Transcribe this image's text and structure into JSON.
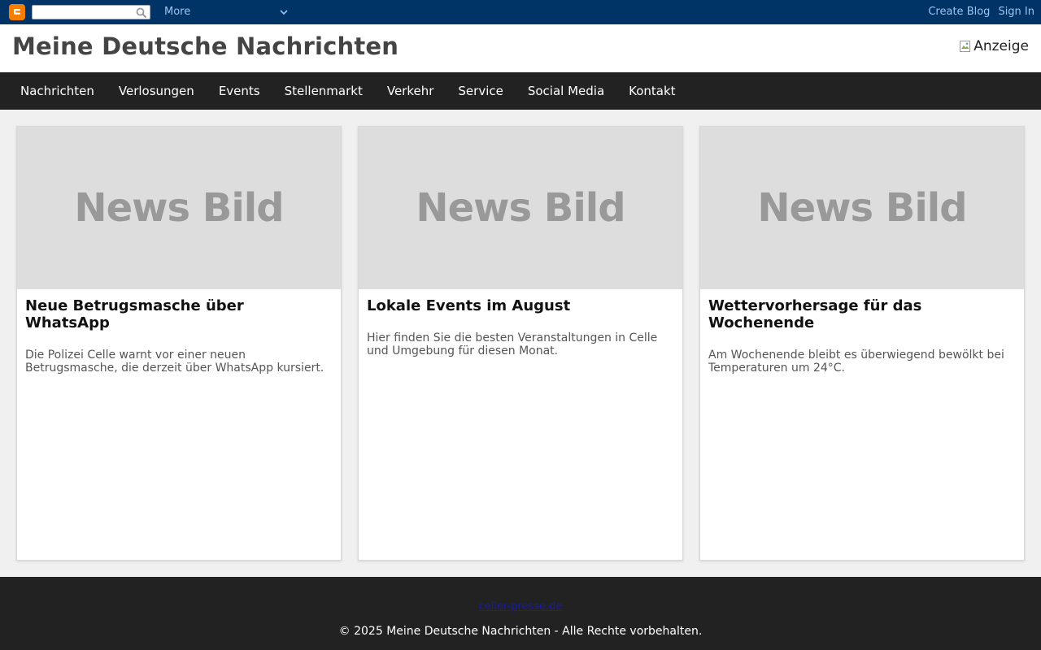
{
  "navbar": {
    "logo_icon": "blogger-logo-icon",
    "search_placeholder": "",
    "more_label": "More",
    "create_blog": "Create Blog",
    "sign_in": "Sign In"
  },
  "header": {
    "title": "Meine Deutsche Nachrichten",
    "ad_alt": "Anzeige"
  },
  "nav": {
    "items": [
      {
        "label": "Nachrichten"
      },
      {
        "label": "Verlosungen"
      },
      {
        "label": "Events"
      },
      {
        "label": "Stellenmarkt"
      },
      {
        "label": "Verkehr"
      },
      {
        "label": "Service"
      },
      {
        "label": "Social Media"
      },
      {
        "label": "Kontakt"
      }
    ]
  },
  "articles": [
    {
      "image_text": "News Bild",
      "title": "Neue Betrugsmasche über WhatsApp",
      "text": "Die Polizei Celle warnt vor einer neuen Betrugsmasche, die derzeit über WhatsApp kursiert."
    },
    {
      "image_text": "News Bild",
      "title": "Lokale Events im August",
      "text": "Hier finden Sie die besten Veranstaltungen in Celle und Umgebung für diesen Monat."
    },
    {
      "image_text": "News Bild",
      "title": "Wettervorhersage für das Wochenende",
      "text": "Am Wochenende bleibt es überwiegend bewölkt bei Temperaturen um 24°C."
    }
  ],
  "footer": {
    "link": "celler-presse.de",
    "copyright": "© 2025 Meine Deutsche Nachrichten - Alle Rechte vorbehalten."
  },
  "colors": {
    "navbar_bg": "#003366",
    "nav_bg": "#222222",
    "blogger_orange": "#f57d00",
    "link_blue": "#9fc5ee"
  }
}
